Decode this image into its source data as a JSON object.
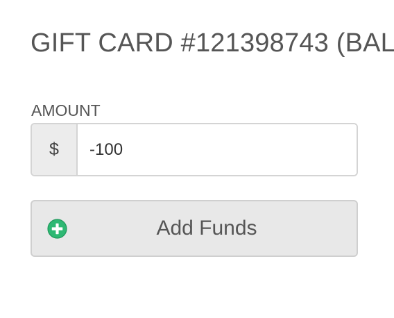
{
  "header": {
    "title": "GIFT CARD #121398743 (BAL"
  },
  "form": {
    "amount_label": "AMOUNT",
    "currency_symbol": "$",
    "amount_value": "-100"
  },
  "actions": {
    "add_funds_label": "Add Funds",
    "add_icon": "plus-circle-icon",
    "add_icon_color": "#2eb873"
  }
}
